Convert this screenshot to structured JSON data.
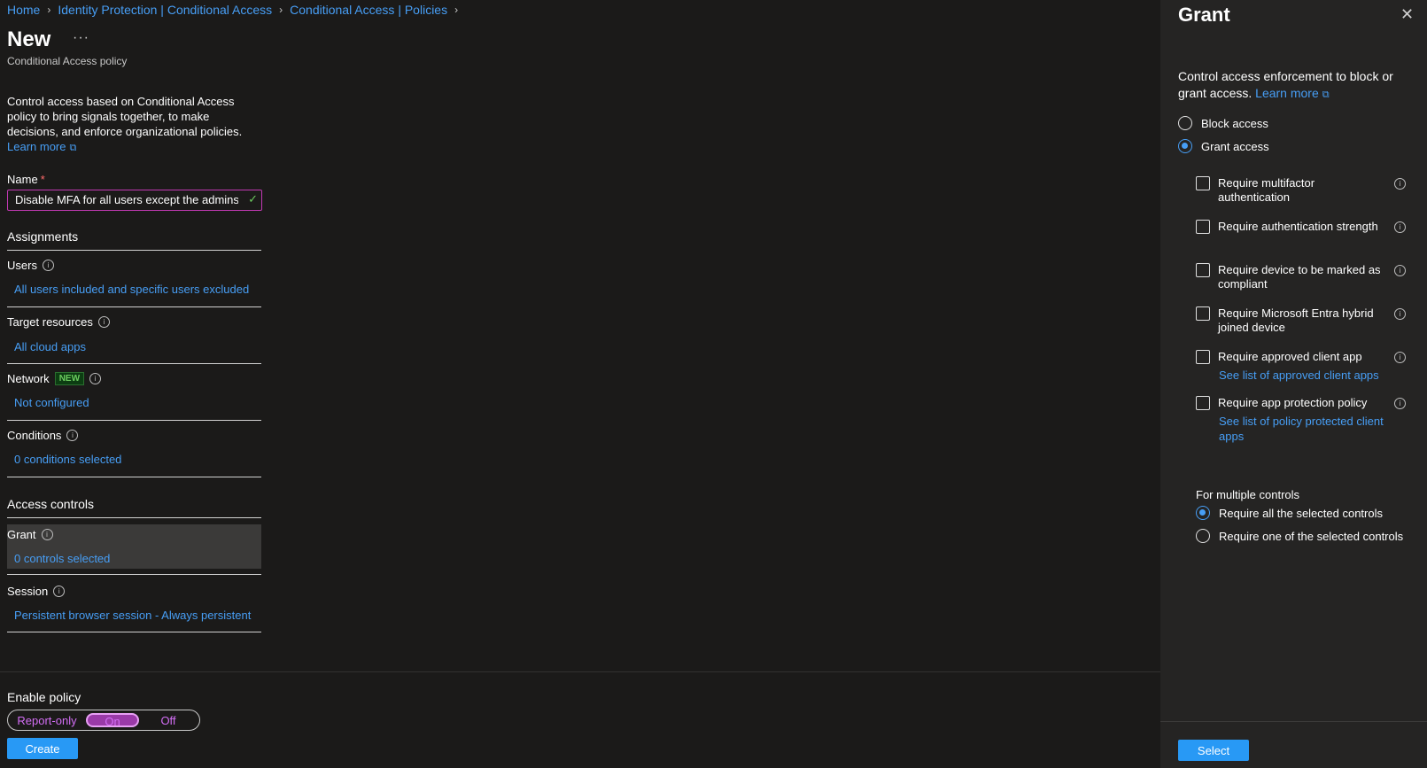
{
  "breadcrumb": {
    "items": [
      "Home",
      "Identity Protection | Conditional Access",
      "Conditional Access | Policies"
    ],
    "separator": ">"
  },
  "header": {
    "title": "New",
    "more": "···",
    "subtitle": "Conditional Access policy"
  },
  "intro": {
    "text": "Control access based on Conditional Access policy to bring signals together, to make decisions, and enforce organizational policies.",
    "learn_more": "Learn more"
  },
  "name_field": {
    "label": "Name",
    "required_mark": "*",
    "value": "Disable MFA for all users except the admins"
  },
  "assignments": {
    "heading": "Assignments",
    "users": {
      "label": "Users",
      "value": "All users included and specific users excluded"
    },
    "target_resources": {
      "label": "Target resources",
      "value": "All cloud apps"
    },
    "network": {
      "label": "Network",
      "badge": "NEW",
      "value": "Not configured"
    },
    "conditions": {
      "label": "Conditions",
      "value": "0 conditions selected"
    }
  },
  "access_controls": {
    "heading": "Access controls",
    "grant": {
      "label": "Grant",
      "value": "0 controls selected"
    },
    "session": {
      "label": "Session",
      "value": "Persistent browser session - Always persistent"
    }
  },
  "enable_policy": {
    "label": "Enable policy",
    "options": [
      "Report-only",
      "On",
      "Off"
    ],
    "selected": "On"
  },
  "create_button": "Create",
  "panel": {
    "title": "Grant",
    "description": "Control access enforcement to block or grant access.",
    "learn_more": "Learn more",
    "block_access": "Block access",
    "grant_access": "Grant access",
    "selected_mode": "Grant access",
    "controls": [
      {
        "label": "Require multifactor authentication"
      },
      {
        "label": "Require authentication strength"
      },
      {
        "label": "Require device to be marked as compliant"
      },
      {
        "label": "Require Microsoft Entra hybrid joined device"
      },
      {
        "label": "Require approved client app",
        "link": "See list of approved client apps"
      },
      {
        "label": "Require app protection policy",
        "link": "See list of policy protected client apps"
      }
    ],
    "multiple_controls": {
      "label": "For multiple controls",
      "require_all": "Require all the selected controls",
      "require_one": "Require one of the selected controls",
      "selected": "Require all the selected controls"
    },
    "select_button": "Select"
  },
  "colors": {
    "background": "#1b1a19",
    "panel_background": "#252423",
    "link": "#479ef5",
    "primary_button": "#2899f5",
    "accent_toggle": "#c239b3",
    "success_check": "#6ccb5f"
  },
  "icons": {
    "info": "info-icon",
    "external_link": "external-link-icon",
    "close": "close-icon",
    "chevron": "chevron-right-icon",
    "check": "checkmark-icon",
    "more": "more-icon"
  }
}
